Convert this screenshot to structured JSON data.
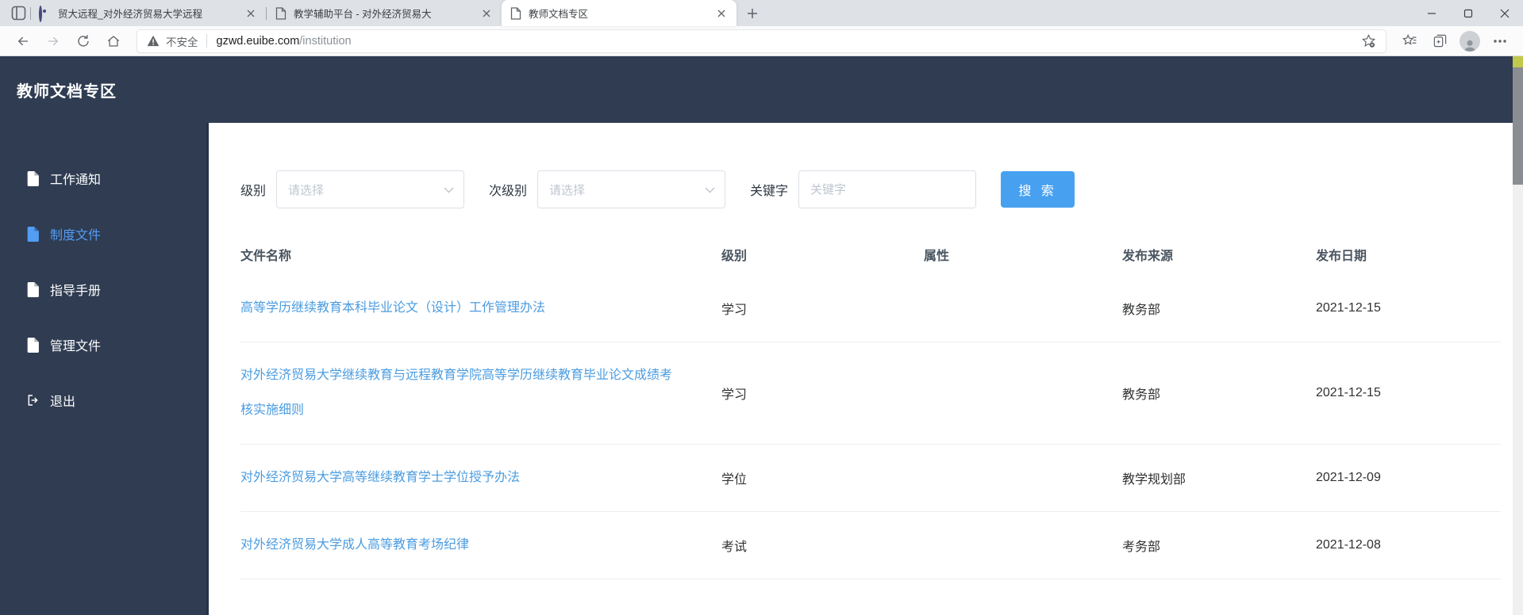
{
  "browser": {
    "tabs": [
      {
        "title": "贸大远程_对外经济贸易大学远程",
        "active": false
      },
      {
        "title": "教学辅助平台 - 对外经济贸易大",
        "active": false
      },
      {
        "title": "教师文档专区",
        "active": true
      }
    ],
    "address": {
      "security_label": "不安全",
      "url_host": "gzwd.euibe.com",
      "url_path": "/institution"
    }
  },
  "page": {
    "title": "教师文档专区",
    "sidebar": {
      "items": [
        {
          "label": "工作通知",
          "active": false
        },
        {
          "label": "制度文件",
          "active": true
        },
        {
          "label": "指导手册",
          "active": false
        },
        {
          "label": "管理文件",
          "active": false
        }
      ],
      "logout_label": "退出"
    },
    "filters": {
      "level_label": "级别",
      "level_placeholder": "请选择",
      "sublevel_label": "次级别",
      "sublevel_placeholder": "请选择",
      "keyword_label": "关键字",
      "keyword_placeholder": "关键字",
      "keyword_value": "",
      "search_label": "搜 索"
    },
    "table": {
      "headers": [
        "文件名称",
        "级别",
        "属性",
        "发布来源",
        "发布日期"
      ],
      "rows": [
        {
          "name": "高等学历继续教育本科毕业论文（设计）工作管理办法",
          "level": "学习",
          "attr": "",
          "source": "教务部",
          "date": "2021-12-15"
        },
        {
          "name": "对外经济贸易大学继续教育与远程教育学院高等学历继续教育毕业论文成绩考核实施细则",
          "level": "学习",
          "attr": "",
          "source": "教务部",
          "date": "2021-12-15"
        },
        {
          "name": "对外经济贸易大学高等继续教育学士学位授予办法",
          "level": "学位",
          "attr": "",
          "source": "教学规划部",
          "date": "2021-12-09"
        },
        {
          "name": "对外经济贸易大学成人高等教育考场纪律",
          "level": "考试",
          "attr": "",
          "source": "考务部",
          "date": "2021-12-08"
        }
      ]
    },
    "colors": {
      "header_navy": "#2f3c52",
      "accent_blue": "#47a1f0",
      "link_blue": "#4b9ce0",
      "sidebar_active_blue": "#539df5"
    }
  }
}
